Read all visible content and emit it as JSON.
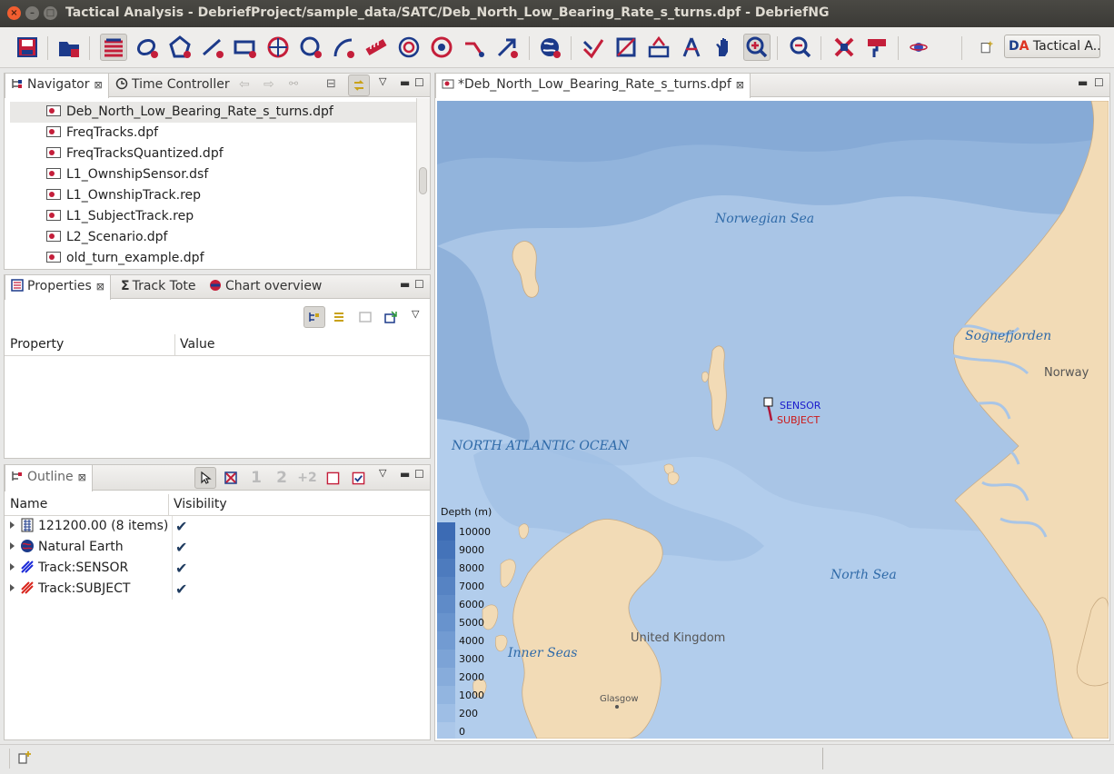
{
  "window": {
    "title": "Tactical Analysis - DebriefProject/sample_data/SATC/Deb_North_Low_Bearing_Rate_s_turns.dpf - DebriefNG"
  },
  "colors": {
    "accent_red": "#d0222b",
    "accent_blue": "#1c3a8a",
    "sensor_label": "#1a1acc",
    "subject_label": "#cc1a1a",
    "land": "#f2dbb6",
    "sea": "#a9c5e6"
  },
  "toolbar": {
    "icons": [
      "save-icon",
      "open-icon",
      "layers-icon",
      "ellipse-icon",
      "polygon-icon",
      "line-icon",
      "rectangle-icon",
      "grid-icon",
      "circle-icon",
      "arc-icon",
      "ruler-icon",
      "range-rings-icon",
      "target-icon",
      "vector-icon",
      "arrow-icon",
      "globe-icon",
      "fit-icon",
      "rescale-icon",
      "redraw-icon",
      "measure-icon",
      "pan-icon",
      "zoom-in-icon",
      "zoom-out-icon",
      "remove-icon",
      "paint-icon",
      "planet-icon"
    ]
  },
  "perspective": {
    "label": "Tactical A..."
  },
  "navigator": {
    "tabs": [
      {
        "label": "Navigator"
      },
      {
        "label": "Time Controller"
      }
    ],
    "files": [
      {
        "name": "Deb_North_Low_Bearing_Rate_s_turns.dpf",
        "selected": true
      },
      {
        "name": "FreqTracks.dpf"
      },
      {
        "name": "FreqTracksQuantized.dpf"
      },
      {
        "name": "L1_OwnshipSensor.dsf"
      },
      {
        "name": "L1_OwnshipTrack.rep"
      },
      {
        "name": "L1_SubjectTrack.rep"
      },
      {
        "name": "L2_Scenario.dpf"
      },
      {
        "name": "old_turn_example.dpf"
      }
    ]
  },
  "properties": {
    "tabs": [
      {
        "label": "Properties"
      },
      {
        "label": "Track Tote"
      },
      {
        "label": "Chart overview"
      }
    ],
    "columns": [
      "Property",
      "Value"
    ]
  },
  "outline": {
    "tab": "Outline",
    "columns": [
      "Name",
      "Visibility"
    ],
    "rows": [
      {
        "name": "121200.00 (8 items)",
        "icon": "grid-icon",
        "visible": "✔"
      },
      {
        "name": "Natural Earth",
        "icon": "globe-icon",
        "visible": "✔"
      },
      {
        "name": "Track:SENSOR",
        "icon": "track-sensor-icon",
        "visible": "✔"
      },
      {
        "name": "Track:SUBJECT",
        "icon": "track-subject-icon",
        "visible": "✔"
      }
    ]
  },
  "editor": {
    "tab": "*Deb_North_Low_Bearing_Rate_s_turns.dpf"
  },
  "map": {
    "labels": {
      "norwegian_sea": "Norwegian Sea",
      "north_atlantic": "NORTH ATLANTIC OCEAN",
      "north_sea": "North Sea",
      "inner_seas": "Inner Seas",
      "sognefjorden": "Sognefjorden",
      "norway": "Norway",
      "uk": "United Kingdom",
      "glasgow": "Glasgow",
      "sensor": "SENSOR",
      "subject": "SUBJECT"
    },
    "legend": {
      "title": "Depth (m)",
      "levels": [
        "10000",
        "9000",
        "8000",
        "7000",
        "6000",
        "5000",
        "4000",
        "3000",
        "2000",
        "1000",
        "200",
        "0"
      ]
    }
  }
}
